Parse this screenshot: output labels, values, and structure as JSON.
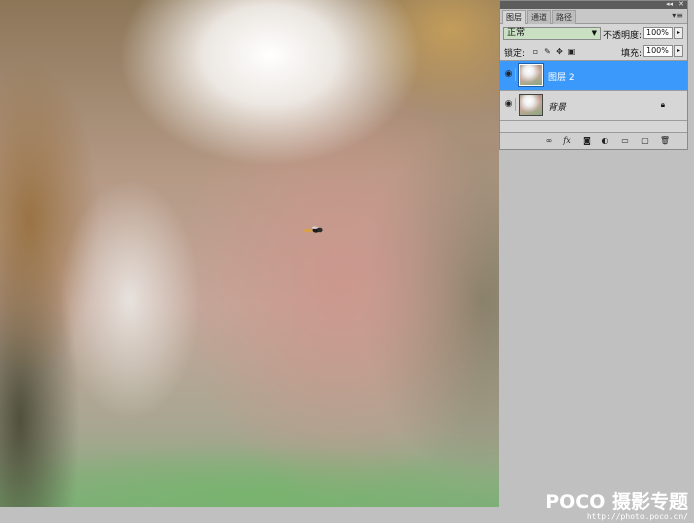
{
  "panel": {
    "tabs": [
      {
        "label": "图层",
        "active": true
      },
      {
        "label": "通道",
        "active": false
      },
      {
        "label": "路径",
        "active": false
      }
    ],
    "blend_mode": "正常",
    "opacity_label": "不透明度:",
    "opacity_value": "100%",
    "lock_label": "锁定:",
    "fill_label": "填充:",
    "fill_value": "100%",
    "layers": [
      {
        "name": "图层 2",
        "selected": true
      },
      {
        "name": "背景",
        "selected": false,
        "locked": true
      }
    ],
    "footer_icons": [
      "link-icon",
      "fx-icon",
      "mask-icon",
      "adjustment-icon",
      "group-icon",
      "new-layer-icon",
      "trash-icon"
    ]
  },
  "watermark": {
    "brand": "POCO 摄影专题",
    "url": "http://photo.poco.cn/"
  },
  "colors": {
    "selected_layer": "#3b99fc",
    "panel_bg": "#d6d6d6",
    "workspace_bg": "#c0c0c0",
    "blend_field_bg": "#c9e0c3"
  }
}
